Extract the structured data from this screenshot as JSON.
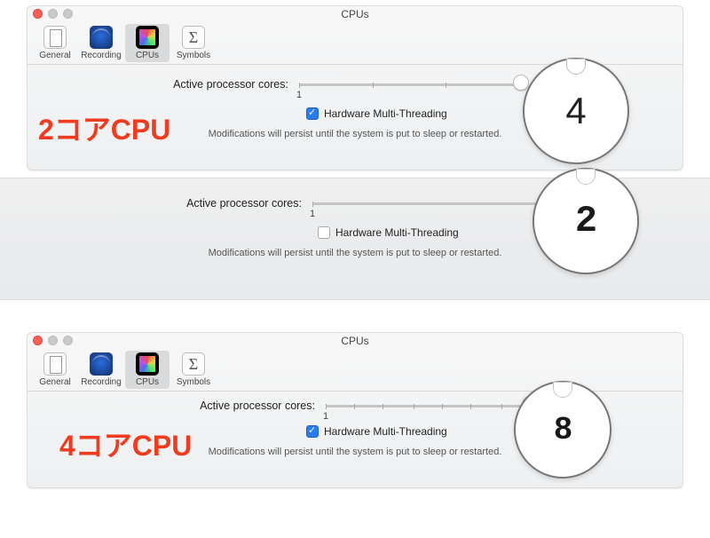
{
  "window_title": "CPUs",
  "toolbar": {
    "general": "General",
    "recording": "Recording",
    "cpus": "CPUs",
    "symbols": "Symbols"
  },
  "slider_label": "Active processor cores:",
  "tick_min": "1",
  "checkbox_label": "Hardware Multi-Threading",
  "footnote": "Modifications will persist until the system is put to sleep or restarted.",
  "annotation_2core": "2コアCPU",
  "annotation_4core": "4コアCPU",
  "zoom_values": {
    "top": "4",
    "mid": "2",
    "bot": "8"
  },
  "chart_data": [
    {
      "type": "scalar",
      "label": "Active processor cores (2-core CPU, HMT on)",
      "value": 4,
      "range": [
        1,
        4
      ]
    },
    {
      "type": "scalar",
      "label": "Active processor cores (2-core CPU, HMT off)",
      "value": 2,
      "range": [
        1,
        2
      ]
    },
    {
      "type": "scalar",
      "label": "Active processor cores (4-core CPU, HMT on)",
      "value": 8,
      "range": [
        1,
        8
      ]
    }
  ]
}
